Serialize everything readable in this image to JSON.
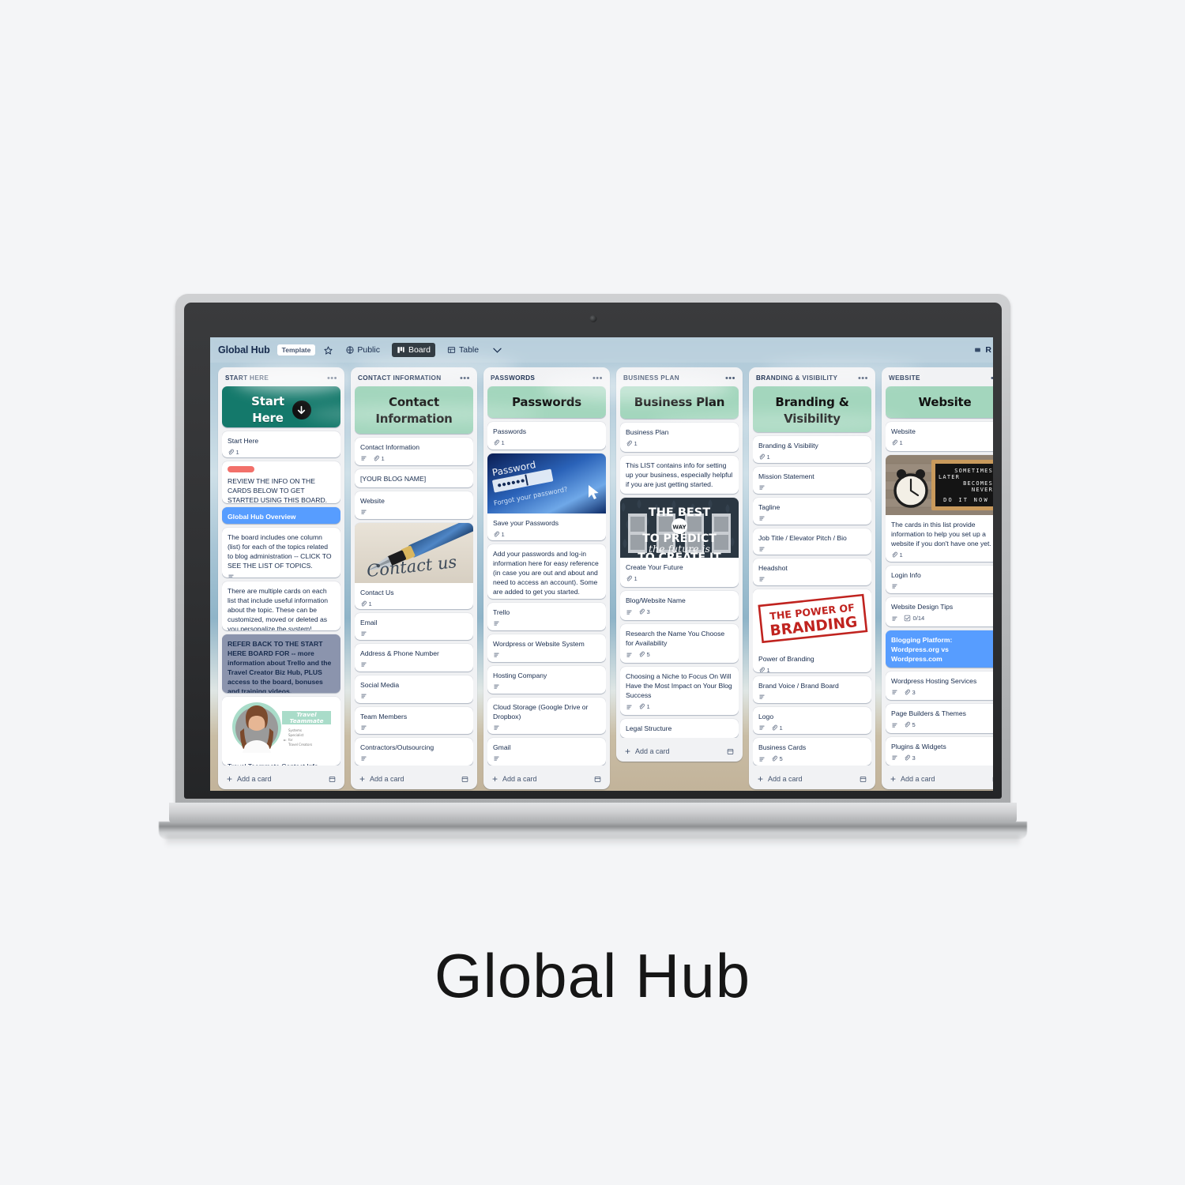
{
  "page": {
    "caption": "Global Hub"
  },
  "topbar": {
    "board_title": "Global Hub",
    "template_badge": "Template",
    "star_icon": "star-icon",
    "visibility_icon": "globe-icon",
    "visibility": "Public",
    "view_board_icon": "board-view-icon",
    "view_board": "Board",
    "view_table_icon": "table-view-icon",
    "view_table": "Table",
    "chevron_icon": "chevron-down-icon",
    "right_partial": "R"
  },
  "colors": {
    "mint": "#a3d6bd",
    "teal": "#14796b",
    "blue_card": "#579dff",
    "slate_card": "#8b94ad",
    "red_label": "#f2706a",
    "text": "#172b4d"
  },
  "add_card_label": "Add a card",
  "lists": [
    {
      "title": "START HERE",
      "menu_icon": "list-menu-icon",
      "cards": [
        {
          "type": "banner_teal",
          "text": "Start Here",
          "icon": "down-arrow-icon"
        },
        {
          "type": "text",
          "title": "Start Here",
          "attachments": "1"
        },
        {
          "type": "label_text",
          "label_color": "#f2706a",
          "title": "REVIEW THE INFO ON THE CARDS BELOW TO GET STARTED USING THIS BOARD."
        },
        {
          "type": "colored_blue",
          "title": "Global Hub Overview"
        },
        {
          "type": "text",
          "title": "The board includes one column (list) for each of the topics related to blog administration -- CLICK TO SEE THE LIST OF TOPICS.",
          "description": true
        },
        {
          "type": "text",
          "title": "There are multiple cards on each list that include useful information about the topic. These can be customized, moved or deleted as you personalize the system!"
        },
        {
          "type": "colored_slate",
          "title": "REFER BACK TO THE START HERE BOARD FOR -- more information about Trello and the Travel Creator Biz Hub, PLUS access to the board, bonuses and training videos."
        },
        {
          "type": "cover_text",
          "cover": "travel-teammate-headshot-cover",
          "title": "Travel Teammate Contact Info",
          "cover_text": {
            "brand": "Travel Teammate",
            "line1": "Systems",
            "line2": "Specialist",
            "line3": "for",
            "line4": "Travel Creators"
          }
        }
      ]
    },
    {
      "title": "CONTACT INFORMATION",
      "menu_icon": "list-menu-icon",
      "cards": [
        {
          "type": "banner_mint",
          "text": "Contact Information"
        },
        {
          "type": "text",
          "title": "Contact Information",
          "description": true,
          "attachments": "1"
        },
        {
          "type": "text",
          "title": "[YOUR BLOG NAME]"
        },
        {
          "type": "text",
          "title": "Website",
          "description": true
        },
        {
          "type": "cover_text",
          "cover": "fountain-pen-contact-us-cover",
          "cover_text": {
            "brand": "Contact us"
          },
          "title": "Contact Us",
          "attachments": "1"
        },
        {
          "type": "text",
          "title": "Email",
          "description": true
        },
        {
          "type": "text",
          "title": "Address & Phone Number",
          "description": true
        },
        {
          "type": "text",
          "title": "Social Media",
          "description": true
        },
        {
          "type": "text",
          "title": "Team Members",
          "description": true
        },
        {
          "type": "text",
          "title": "Contractors/Outsourcing",
          "description": true
        }
      ]
    },
    {
      "title": "PASSWORDS",
      "menu_icon": "list-menu-icon",
      "cards": [
        {
          "type": "banner_mint",
          "text": "Passwords"
        },
        {
          "type": "text",
          "title": "Passwords",
          "attachments": "1"
        },
        {
          "type": "cover_text",
          "cover": "password-login-screen-cover",
          "cover_text": {
            "brand": "Password",
            "sub": "Forgot your password?"
          },
          "title": "Save your Passwords",
          "attachments": "1"
        },
        {
          "type": "text",
          "title": "Add your passwords and log-in information here for easy reference (in case you are out and about and need to access an account). Some are added to get you started."
        },
        {
          "type": "text",
          "title": "Trello",
          "description": true
        },
        {
          "type": "text",
          "title": "Wordpress or Website System",
          "description": true
        },
        {
          "type": "text",
          "title": "Hosting Company",
          "description": true
        },
        {
          "type": "text",
          "title": "Cloud Storage (Google Drive or Dropbox)",
          "description": true
        },
        {
          "type": "text",
          "title": "Gmail",
          "description": true
        }
      ]
    },
    {
      "title": "BUSINESS PLAN",
      "menu_icon": "list-menu-icon",
      "cards": [
        {
          "type": "banner_mint",
          "text": "Business Plan"
        },
        {
          "type": "text",
          "title": "Business Plan",
          "attachments": "1"
        },
        {
          "type": "text",
          "title": "This LIST contains info for setting up your business, especially helpful if you are just getting started."
        },
        {
          "type": "cover_text",
          "cover": "doors-best-way-predict-future-cover",
          "cover_text": {
            "l1": "THE BEST",
            "badge": "WAY",
            "l2": "TO PREDICT",
            "l3": "the future is",
            "l4": "TO CREATE IT"
          },
          "title": "Create Your Future",
          "attachments": "1"
        },
        {
          "type": "text",
          "title": "Blog/Website Name",
          "description": true,
          "attachments": "3"
        },
        {
          "type": "text",
          "title": "Research the Name You Choose for Availability",
          "description": true,
          "attachments": "5"
        },
        {
          "type": "text",
          "title": "Choosing a Niche to Focus On Will Have the Most Impact on Your Blog Success",
          "description": true,
          "attachments": "1"
        },
        {
          "type": "text",
          "title": "Legal Structure"
        }
      ]
    },
    {
      "title": "BRANDING & VISIBILITY",
      "menu_icon": "list-menu-icon",
      "cards": [
        {
          "type": "banner_mint",
          "text": "Branding & Visibility"
        },
        {
          "type": "text",
          "title": "Branding & Visibility",
          "attachments": "1"
        },
        {
          "type": "text",
          "title": "Mission Statement",
          "description": true
        },
        {
          "type": "text",
          "title": "Tagline",
          "description": true
        },
        {
          "type": "text",
          "title": "Job Title / Elevator Pitch / Bio",
          "description": true
        },
        {
          "type": "text",
          "title": "Headshot",
          "description": true
        },
        {
          "type": "cover_text",
          "cover": "power-of-branding-stamp-cover",
          "cover_text": {
            "l1": "THE POWER OF",
            "l2": "BRANDING"
          },
          "title": "Power of Branding",
          "attachments": "1"
        },
        {
          "type": "text",
          "title": "Brand Voice / Brand Board",
          "description": true
        },
        {
          "type": "text",
          "title": "Logo",
          "description": true,
          "attachments": "1"
        },
        {
          "type": "text",
          "title": "Business Cards",
          "description": true,
          "attachments": "5"
        }
      ]
    },
    {
      "title": "WEBSITE",
      "menu_icon": "list-menu-icon",
      "cards": [
        {
          "type": "banner_mint",
          "text": "Website"
        },
        {
          "type": "text",
          "title": "Website",
          "attachments": "1"
        },
        {
          "type": "cover_text",
          "cover": "clock-letterboard-do-it-now-cover",
          "cover_text": {
            "l1": "SOMETIMES",
            "l2": "LATER",
            "l3": "BECOMES",
            "l4": "NEVER",
            "l5": "DO IT NOW"
          },
          "title": "The cards in this list provide information to help you set up a website if you don't have one yet.",
          "attachments": "1"
        },
        {
          "type": "text",
          "title": "Login Info",
          "description": true
        },
        {
          "type": "text",
          "title": "Website Design Tips",
          "description": true,
          "checklist": "0/14"
        },
        {
          "type": "colored_blue",
          "title": "Blogging Platform: Wordpress.org vs Wordpress.com"
        },
        {
          "type": "text",
          "title": "Wordpress Hosting Services",
          "description": true,
          "attachments": "3"
        },
        {
          "type": "text",
          "title": "Page Builders & Themes",
          "description": true,
          "attachments": "5"
        },
        {
          "type": "text",
          "title": "Plugins & Widgets",
          "description": true,
          "attachments": "3"
        }
      ]
    }
  ]
}
